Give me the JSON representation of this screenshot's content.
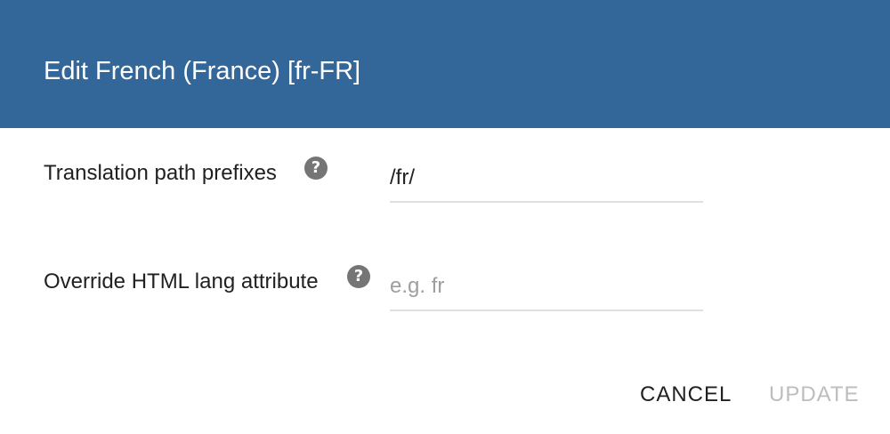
{
  "dialog": {
    "title": "Edit French (France) [fr-FR]",
    "header_color": "#336699"
  },
  "fields": {
    "prefixes": {
      "label": "Translation path prefixes",
      "help_icon": "question-circle-icon",
      "value": "/fr/",
      "placeholder": ""
    },
    "lang": {
      "label": "Override HTML lang attribute",
      "help_icon": "question-circle-icon",
      "value": "",
      "placeholder": "e.g. fr"
    }
  },
  "actions": {
    "cancel_label": "CANCEL",
    "update_label": "UPDATE",
    "update_disabled": true
  }
}
